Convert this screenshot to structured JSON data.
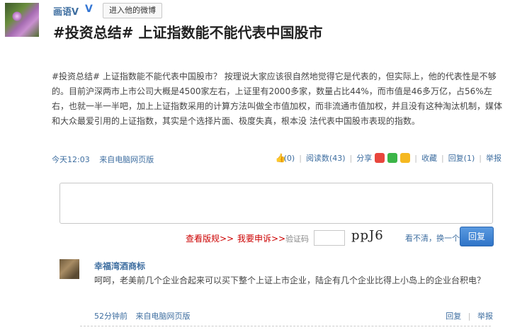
{
  "post": {
    "author": "画语V",
    "badge": "V",
    "visit_button": "进入他的微博",
    "title": "#投资总结#  上证指数能不能代表中国股市",
    "content": "#投资总结# 上证指数能不能代表中国股市？  按理说大家应该很自然地觉得它是代表的，但实际上，他的代表性是不够的。目前沪深两市上市公司大概是4500家左右，上证里有2000多家，数量占比44%，而市值是46多万亿，占56%左右，也就一半一半吧，加上上证指数采用的计算方法叫做全市值加权，而非流通市值加权，并且没有这种淘汰机制，媒体和大众最爱引用的上证指数，其实是个选择片面、极度失真，根本没 法代表中国股市表现的指数。",
    "time": "今天12:03",
    "source": "来自电脑网页版",
    "like_count": "(0)",
    "read_count": "阅读数(43)",
    "share_label": "分享",
    "favorite_label": "收藏",
    "reply_label": "回复(1)",
    "report_label": "举报"
  },
  "comment_form": {
    "rules_link": "查看版规>>",
    "appeal_link": "我要申诉>>",
    "captcha_label": "验证码",
    "captcha_text": "ppJ6",
    "refresh_link": "看不清，换一个",
    "submit_label": "回复"
  },
  "comments": [
    {
      "author": "幸福湾酒商标",
      "text": "呵呵，老美前几个企业合起来可以买下整个上证上市企业，陆企有几个企业比得上小岛上的企业台积电？",
      "time": "52分钟前",
      "source": "来自电脑网页版",
      "reply_label": "回复",
      "report_label": "举报"
    }
  ]
}
